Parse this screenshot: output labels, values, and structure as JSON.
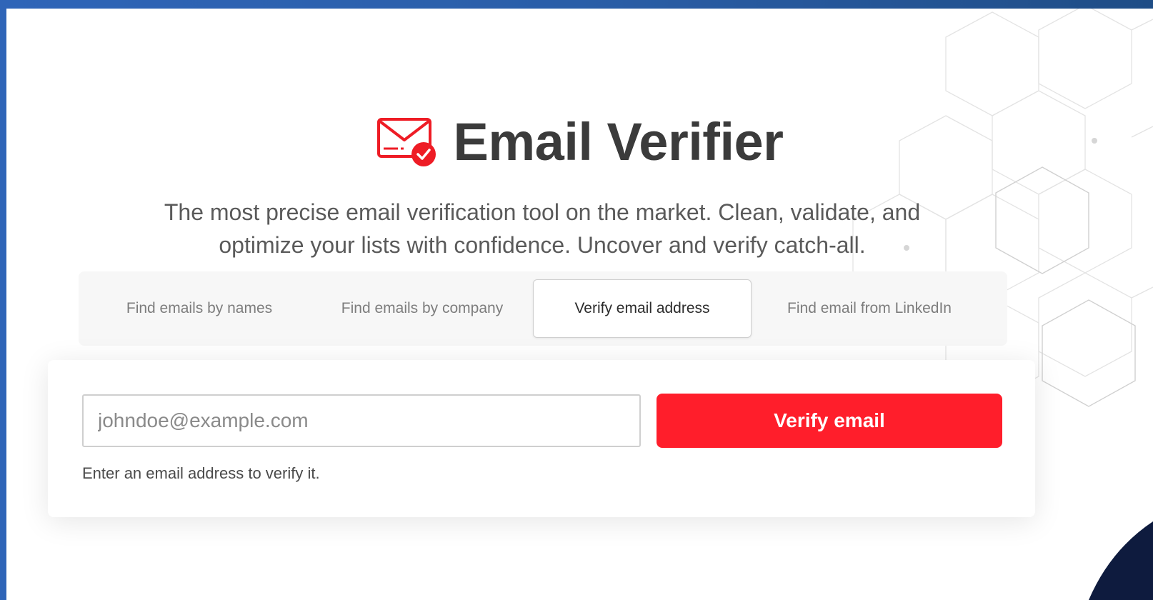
{
  "header": {
    "logo_icon": "envelope-check-icon",
    "title": "Email Verifier",
    "subtitle": "The most precise email verification tool on the market. Clean, validate, and optimize your lists with confidence. Uncover and verify catch-all."
  },
  "tabs": [
    {
      "label": "Find emails by names",
      "active": false
    },
    {
      "label": "Find emails by company",
      "active": false
    },
    {
      "label": "Verify email address",
      "active": true
    },
    {
      "label": "Find email from LinkedIn",
      "active": false
    }
  ],
  "form": {
    "email_placeholder": "johndoe@example.com",
    "email_value": "",
    "submit_label": "Verify email",
    "hint": "Enter an email address to verify it."
  },
  "colors": {
    "accent": "#ff1e2b",
    "title": "#3b3b3b",
    "frame_border": "#2f65b8"
  }
}
